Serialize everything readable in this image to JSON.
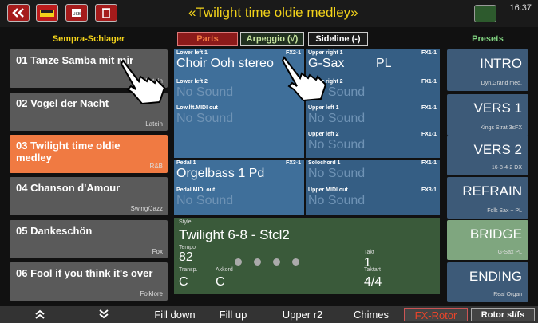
{
  "topbar": {
    "title": "«Twilight time oldie medley»",
    "clock": "16:37",
    "icons": [
      "double-left-chevron-icon",
      "keyboard-icon",
      "usb-icon",
      "trash-icon",
      "display-icon"
    ]
  },
  "left": {
    "header": "Sempra-Schlager",
    "songs": [
      {
        "name": "01 Tanze Samba mit mir",
        "genre": "Latein"
      },
      {
        "name": "02 Vogel der Nacht",
        "genre": "Latein"
      },
      {
        "name": "03 Twilight time oldie medley",
        "genre": "R&B"
      },
      {
        "name": "04 Chanson d'Amour",
        "genre": "Swing/Jazz"
      },
      {
        "name": "05 Dankeschön",
        "genre": "Fox"
      },
      {
        "name": "06 Fool if you think it's over",
        "genre": "Folklore"
      }
    ]
  },
  "tabs": {
    "parts": "Parts",
    "arpeggio": "Arpeggio (√)",
    "sideline": "Sideline (-)"
  },
  "parts": {
    "lower_left_1": {
      "label": "Lower left 1",
      "value": "Choir Ooh stereo",
      "fx": "FX2-1"
    },
    "lower_left_2": {
      "label": "Lower left 2",
      "value": "No Sound",
      "fx": "FX"
    },
    "low_midi": {
      "label": "Low.lft.MIDI out",
      "value": "No Sound"
    },
    "upper_right_1": {
      "label": "Upper right 1",
      "value": "G-Sax",
      "value2": "PL",
      "fx": "FX1-1"
    },
    "upper_right_2": {
      "label": "Upper right 2",
      "value": "No Sound",
      "fx": "FX1-1"
    },
    "upper_left_1": {
      "label": "Upper left 1",
      "value": "No Sound",
      "fx": "FX1-1"
    },
    "upper_left_2": {
      "label": "Upper left 2",
      "value": "No Sound",
      "fx": "FX1-1"
    },
    "pedal_1": {
      "label": "Pedal 1",
      "value": "Orgelbass 1  Pd",
      "fx": "FX3-1"
    },
    "pedal_midi": {
      "label": "Pedal MIDI out",
      "value": "No Sound"
    },
    "solochord_1": {
      "label": "Solochord 1",
      "value": "No Sound",
      "fx": "FX1-1"
    },
    "upper_midi": {
      "label": "Upper MIDI out",
      "value": "No Sound",
      "fx": "FX3-1"
    }
  },
  "style": {
    "label": "Style",
    "name": "Twilight 6-8 - Stcl2",
    "tempo_label": "Tempo",
    "tempo": "82",
    "takt_label": "Takt",
    "takt": "1",
    "transp_label": "Transp.",
    "transp": "C",
    "akkord_label": "Akkord",
    "akkord": "C",
    "taktart_label": "Taktart",
    "taktart": "4/4"
  },
  "presets": {
    "header": "Presets",
    "items": [
      {
        "name": "INTRO",
        "sub": "Dyn.Grand med."
      },
      {
        "name": "VERS 1",
        "sub": "Kings Strat 3sFX"
      },
      {
        "name": "VERS 2",
        "sub": "16-8-4-2   DX"
      },
      {
        "name": "REFRAIN",
        "sub": "Folk Sax +   PL"
      },
      {
        "name": "BRIDGE",
        "sub": "G-Sax   PL"
      },
      {
        "name": "ENDING",
        "sub": "Real Organ"
      }
    ]
  },
  "bottombar": {
    "up_icon": "double-up-chevron-icon",
    "down_icon": "double-down-chevron-icon",
    "buttons": [
      "Fill down",
      "Fill up",
      "Upper r2",
      "Chimes",
      "FX-Rotor",
      "Rotor sl/fs"
    ]
  },
  "colors": {
    "active_song": "#f07a42",
    "parts_blue": "#3f6f9a",
    "style_green": "#3a5a3a",
    "title_yellow": "#f2d21a",
    "fx_rotor_red": "#e8442a"
  }
}
